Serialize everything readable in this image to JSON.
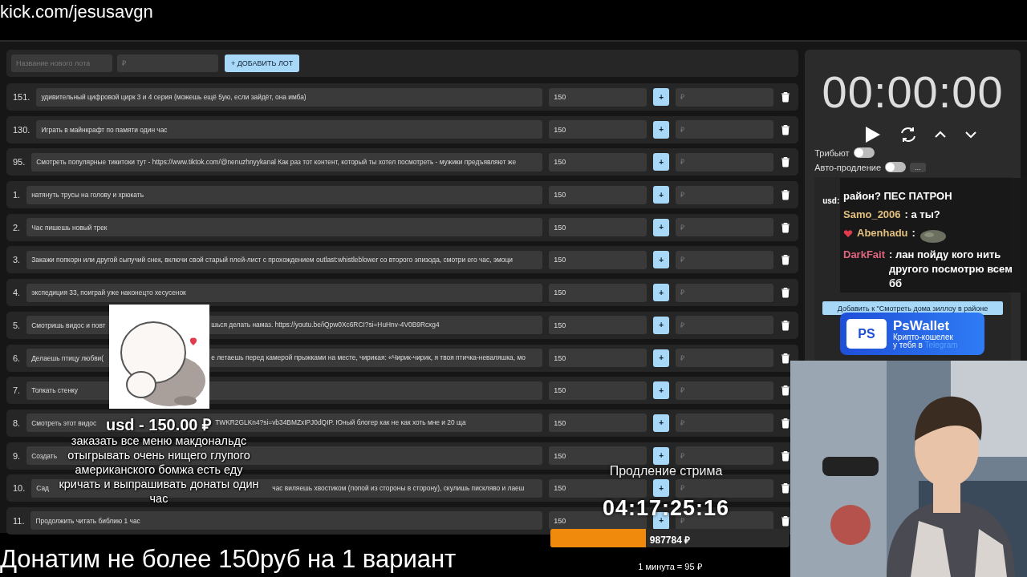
{
  "url_overlay": "kick.com/jesusavgn",
  "new_lot": {
    "name_placeholder": "Название нового лота",
    "price_placeholder": "₽",
    "add_button": "+ ДОБАВИТЬ ЛОТ"
  },
  "lots": [
    {
      "number": "151.",
      "title": "удивительный цифровой цирк 3 и 4 серия (можешь ещё 5ую, если зайдёт, она имба)",
      "amount": "150",
      "add": "+",
      "price_placeholder": "₽"
    },
    {
      "number": "130.",
      "title": "Играть в майнкрафт по памяти один час",
      "amount": "150",
      "add": "+",
      "price_placeholder": "₽"
    },
    {
      "number": "95.",
      "title": "Смотреть популярные тикитоки тут - https://www.tiktok.com/@nenuzhnyykanal Как раз тот контент, который ты хотел посмотреть - мужики предъявляют же",
      "amount": "150",
      "add": "+",
      "price_placeholder": "₽"
    },
    {
      "number": "1.",
      "title": "натянуть трусы на голову и хрюкать",
      "amount": "150",
      "add": "+",
      "price_placeholder": "₽"
    },
    {
      "number": "2.",
      "title": "Час пишешь новый трек",
      "amount": "150",
      "add": "+",
      "price_placeholder": "₽"
    },
    {
      "number": "3.",
      "title": "Закажи попкорн или другой сыпучий снек, включи свой старый плей-лист с прохождением outlast:whistleblower со второго эпизода, смотри его час, эмоци",
      "amount": "150",
      "add": "+",
      "price_placeholder": "₽"
    },
    {
      "number": "4.",
      "title": "экспедиция 33, поиграй уже наконецто хесусенок",
      "amount": "150",
      "add": "+",
      "price_placeholder": "₽"
    },
    {
      "number": "5.",
      "title": "Смотришь видос и повт",
      "title_tail": "шься делать намаз. https://youtu.be/iQpw0Xc6RCI?si=HuHnv-4V0B9Rcxg4",
      "amount": "150",
      "add": "+",
      "price_placeholder": "₽"
    },
    {
      "number": "6.",
      "title": "Делаешь птицу любви(",
      "title_tail": "е летаешь перед камерой прыжками на месте, чирикая: «Чирик-чирик, я твоя птичка-неваляшка, мо",
      "amount": "150",
      "add": "+",
      "price_placeholder": "₽"
    },
    {
      "number": "7.",
      "title": "Толкать стенку",
      "amount": "150",
      "add": "+",
      "price_placeholder": "₽"
    },
    {
      "number": "8.",
      "title": "Смотреть этот видос",
      "title_tail": "TWKR2GLKn4?si=vb34BMZxIPJ0dQIP. Юный блогер как не как хоть мне и 20 ща",
      "amount": "150",
      "add": "+",
      "price_placeholder": "₽"
    },
    {
      "number": "9.",
      "title": "Создать",
      "amount": "150",
      "add": "+",
      "price_placeholder": "₽"
    },
    {
      "number": "10.",
      "title": "Сад",
      "title_tail": "час виляешь хвостиком (попой из стороны в сторону), скулишь пискляво и лаеш",
      "amount": "150",
      "add": "+",
      "price_placeholder": "₽"
    },
    {
      "number": "11.",
      "title": "Продолжить читать библию 1 час",
      "amount": "150",
      "add": "+",
      "price_placeholder": "₽"
    }
  ],
  "timer": {
    "time": "00:00:00"
  },
  "toggles": [
    {
      "label": "Трибьют",
      "on": false
    },
    {
      "label": "Авто-продление",
      "on": false,
      "more": "..."
    }
  ],
  "donation": {
    "user": "usd:",
    "add_button": "Добавить к \"Смотреть дома зиллоу в районе"
  },
  "chat": [
    {
      "kind": "text",
      "text": "район? ПЕС ПАТРОН"
    },
    {
      "kind": "text",
      "user": "Samo_2006",
      "color": "#e2c07e",
      "text": ": а ты?"
    },
    {
      "kind": "emote",
      "user": "Abenhadu",
      "color": "#e2c07e",
      "text": ":",
      "badge": true
    },
    {
      "kind": "text",
      "user": "DarkFait",
      "color": "#e0657e",
      "text": ": лан пойду кого нить другого посмотрю всем бб"
    }
  ],
  "ad": {
    "logo": "PS",
    "title": "PsWallet",
    "line_1": "Крипто-кошелек",
    "line_2": "у тебя в",
    "line_2_accent": "Telegram"
  },
  "donation_alert": {
    "header": "usd - 150.00 ₽",
    "message_lines": [
      "заказать все меню макдональдс",
      "отыгрывать очень нищего глупого",
      "американского бомжа есть еду",
      "кричать и выпрашивать донаты один",
      "час"
    ]
  },
  "extension": {
    "title": "Продление стрима",
    "time": "04:17:25:16",
    "total": "987784 ₽",
    "level": 0.4,
    "rate": "1 минута = 95 ₽"
  },
  "caption": "Донатим не более 150руб на 1 вариант"
}
